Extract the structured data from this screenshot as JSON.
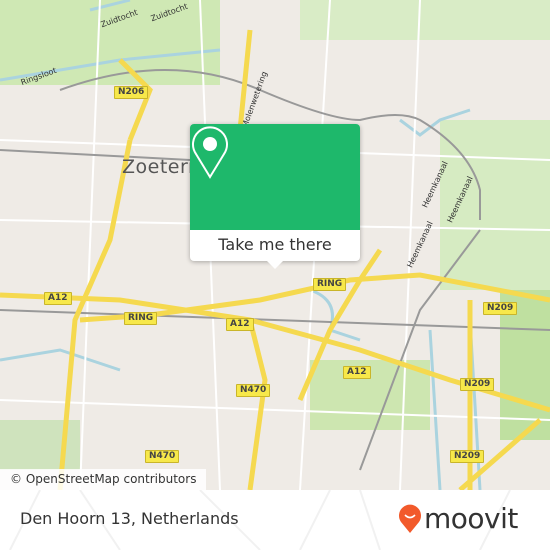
{
  "map": {
    "city_label": "Zoeterm",
    "road_labels": [
      "Zuidtocht",
      "Zuidtocht",
      "Ringsloot",
      "Molenwetering",
      "Heemkanaal",
      "Heemkanaal",
      "Heemkanaal"
    ],
    "shields": [
      "N206",
      "A12",
      "RING",
      "A12",
      "RING",
      "N470",
      "A12",
      "N209",
      "N209",
      "N470",
      "N209"
    ],
    "attribution": "© OpenStreetMap contributors",
    "colors": {
      "land": "#efebe6",
      "water": "#aad3df",
      "park": "#c8e6a8",
      "motorway": "#f5d94f"
    }
  },
  "popup": {
    "icon": "map-pin-icon",
    "button_label": "Take me there",
    "color": "#1eb86b"
  },
  "footer": {
    "address": "Den Hoorn 13, Netherlands",
    "brand": "moovit",
    "brand_color": "#f25a2b"
  }
}
